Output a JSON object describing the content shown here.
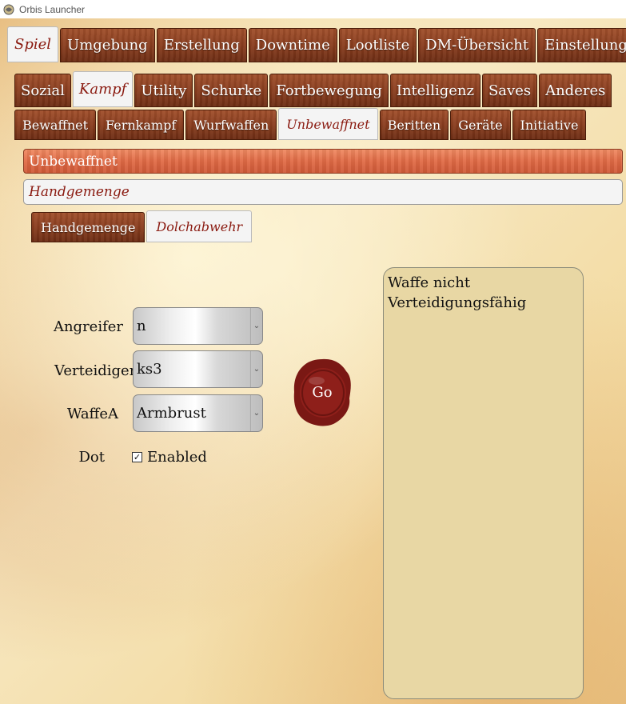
{
  "window": {
    "title": "Orbis Launcher"
  },
  "main_tabs": [
    {
      "label": "Spiel",
      "active": true
    },
    {
      "label": "Umgebung",
      "active": false
    },
    {
      "label": "Erstellung",
      "active": false
    },
    {
      "label": "Downtime",
      "active": false
    },
    {
      "label": "Lootliste",
      "active": false
    },
    {
      "label": "DM-Übersicht",
      "active": false
    },
    {
      "label": "Einstellungen",
      "active": false
    }
  ],
  "category_tabs": [
    {
      "label": "Sozial",
      "active": false
    },
    {
      "label": "Kampf",
      "active": true
    },
    {
      "label": "Utility",
      "active": false
    },
    {
      "label": "Schurke",
      "active": false
    },
    {
      "label": "Fortbewegung",
      "active": false
    },
    {
      "label": "Intelligenz",
      "active": false
    },
    {
      "label": "Saves",
      "active": false
    },
    {
      "label": "Anderes",
      "active": false
    }
  ],
  "combat_tabs": [
    {
      "label": "Bewaffnet",
      "active": false
    },
    {
      "label": "Fernkampf",
      "active": false
    },
    {
      "label": "Wurfwaffen",
      "active": false
    },
    {
      "label": "Unbewaffnet",
      "active": true
    },
    {
      "label": "Beritten",
      "active": false
    },
    {
      "label": "Geräte",
      "active": false
    },
    {
      "label": "Initiative",
      "active": false
    }
  ],
  "section_bar": "Unbewaffnet",
  "subsection_bar": "Handgemenge",
  "action_tabs": [
    {
      "label": "Handgemenge",
      "active": false
    },
    {
      "label": "Dolchabwehr",
      "active": true
    }
  ],
  "form": {
    "attacker_label": "Angreifer",
    "attacker_value": "n",
    "defender_label": "Verteidiger",
    "defender_value": "ks3",
    "weapon_label": "WaffeA",
    "weapon_value": "Armbrust",
    "dot_label": "Dot",
    "dot_checkbox_label": "Enabled",
    "dot_checked": true,
    "go_label": "Go"
  },
  "output": {
    "text": "Waffe nicht Verteidigungsfähig"
  },
  "colors": {
    "wood_tab": "#8a3e1f",
    "active_tab_text": "#8a1a10",
    "parchment": "#f3dfb0",
    "output_bg": "#e8d7a4",
    "seal": "#8e1f1a"
  }
}
